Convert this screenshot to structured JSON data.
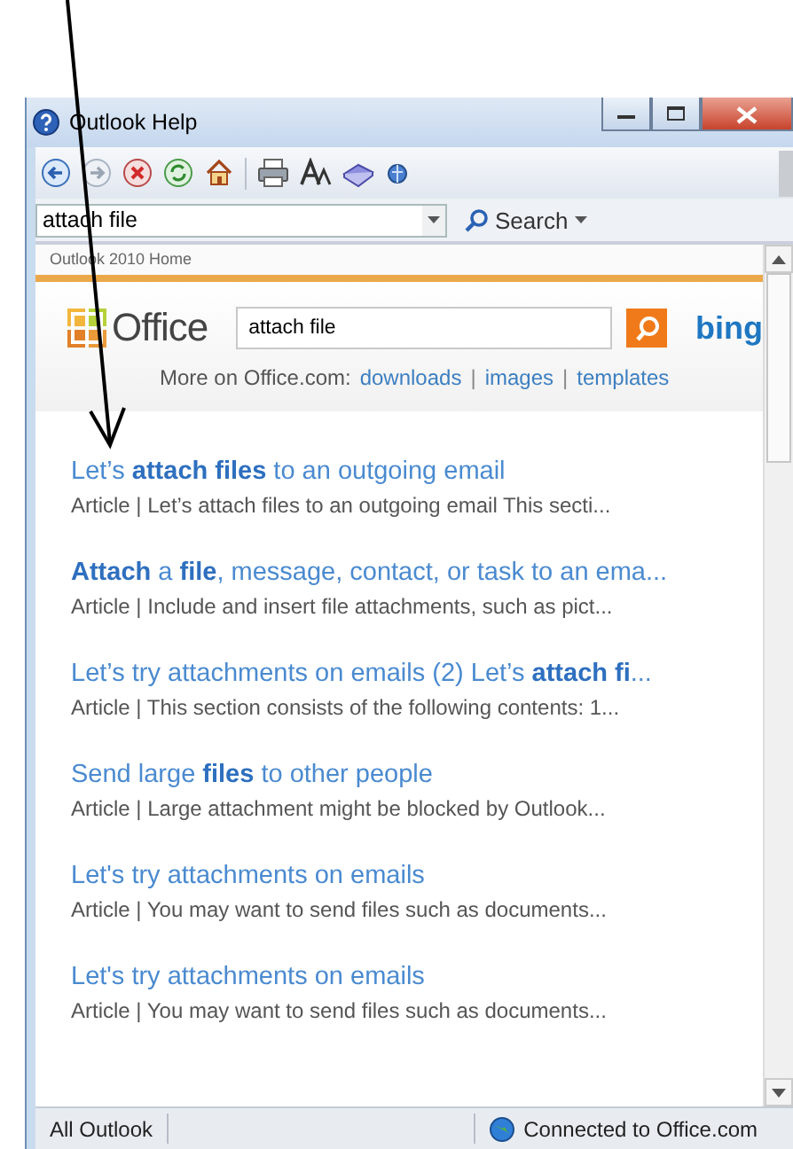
{
  "window": {
    "title": "Outlook Help"
  },
  "search": {
    "value": "attach file",
    "button": "Search"
  },
  "breadcrumb": "Outlook 2010 Home",
  "office_search": {
    "logo": "Office",
    "value": "attach file",
    "brand": "bing"
  },
  "more_on": {
    "label": "More on Office.com:",
    "links": [
      "downloads",
      "images",
      "templates"
    ],
    "separator": "|"
  },
  "results": [
    {
      "title": "Let’s **attach files** to an outgoing email",
      "snippet": "Article | Let’s attach files to an outgoing email This secti..."
    },
    {
      "title": "**Attach** a **file**, message, contact, or task to an ema...",
      "snippet": "Article | Include and insert file attachments, such as pict..."
    },
    {
      "title": "Let’s try attachments on emails (2) Let’s **attach fi**...",
      "snippet": "Article | This section consists of the following contents: 1..."
    },
    {
      "title": "Send large **files** to other people",
      "snippet": "Article | Large attachment might be blocked by Outlook..."
    },
    {
      "title": "Let's try attachments on emails",
      "snippet": "Article | You may want to send files such as documents..."
    },
    {
      "title": "Let's try attachments on emails",
      "snippet": "Article | You may want to send files such as documents..."
    }
  ],
  "status_bar": {
    "scope": "All Outlook",
    "connection": "Connected to Office.com"
  }
}
